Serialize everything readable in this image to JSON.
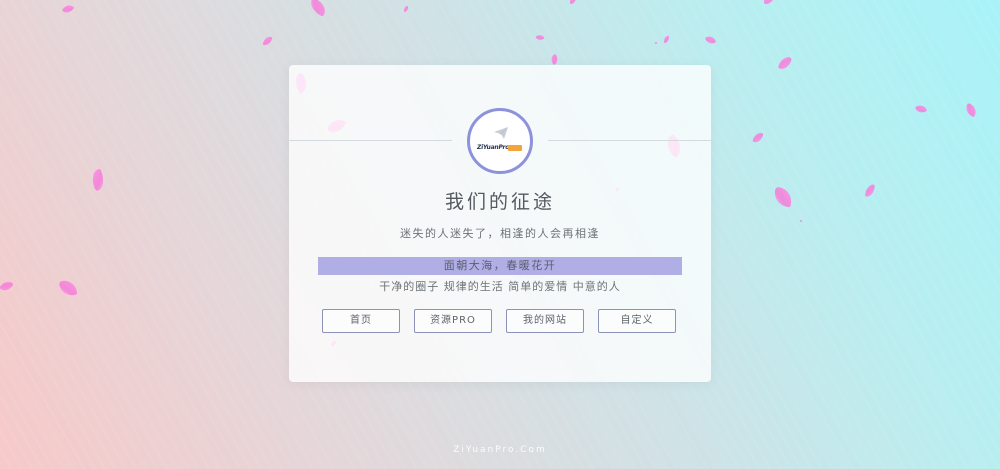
{
  "colors": {
    "accent_ring": "#8d92dc",
    "highlight_bar": "#b1aee6",
    "petal": "#f47ad8",
    "logo_badge": "#f2a53a"
  },
  "logo": {
    "icon": "paper-plane-icon",
    "text": "ZiYuanPro"
  },
  "card": {
    "title": "我们的征途",
    "subtitle": "迷失的人迷失了，相逢的人会再相逢",
    "highlight": "面朝大海，春暖花开",
    "tagline": "干净的圈子 规律的生活 简单的爱情 中意的人"
  },
  "buttons": [
    {
      "label": "首页"
    },
    {
      "label": "资源PRO"
    },
    {
      "label": "我的网站"
    },
    {
      "label": "自定义"
    }
  ],
  "footer": {
    "text": "ZiYuanPro.Com"
  }
}
